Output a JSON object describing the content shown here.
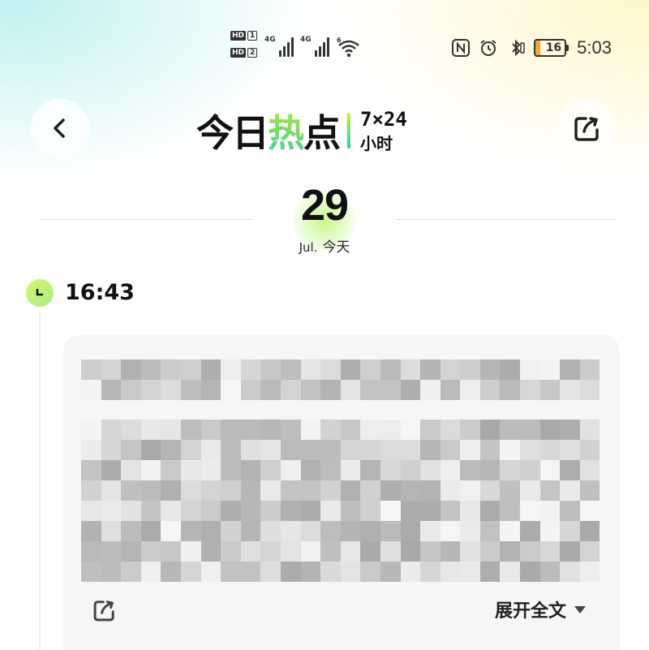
{
  "status_bar": {
    "sim1": {
      "hd": "HD",
      "num": "1"
    },
    "sim2": {
      "hd": "HD",
      "num": "2"
    },
    "signal1_label": "4G",
    "signal2_label": "4G",
    "wifi_label": "6",
    "battery_level": "16",
    "time": "5:03"
  },
  "header": {
    "back_icon": "chevron-left-icon",
    "title_part1": "今日",
    "title_highlight": "热",
    "title_part2": "点",
    "subtitle_top": "7×24",
    "subtitle_bottom": "小时",
    "share_icon": "share-icon"
  },
  "date": {
    "day": "29",
    "month": "Jul.",
    "label": "今天"
  },
  "timeline": {
    "entries": [
      {
        "time": "16:43",
        "expand_label": "展开全文"
      }
    ]
  },
  "colors": {
    "accent_green": "#b8e63a",
    "accent_teal": "#3fcf9b",
    "battery_fill": "#f2a53b"
  }
}
